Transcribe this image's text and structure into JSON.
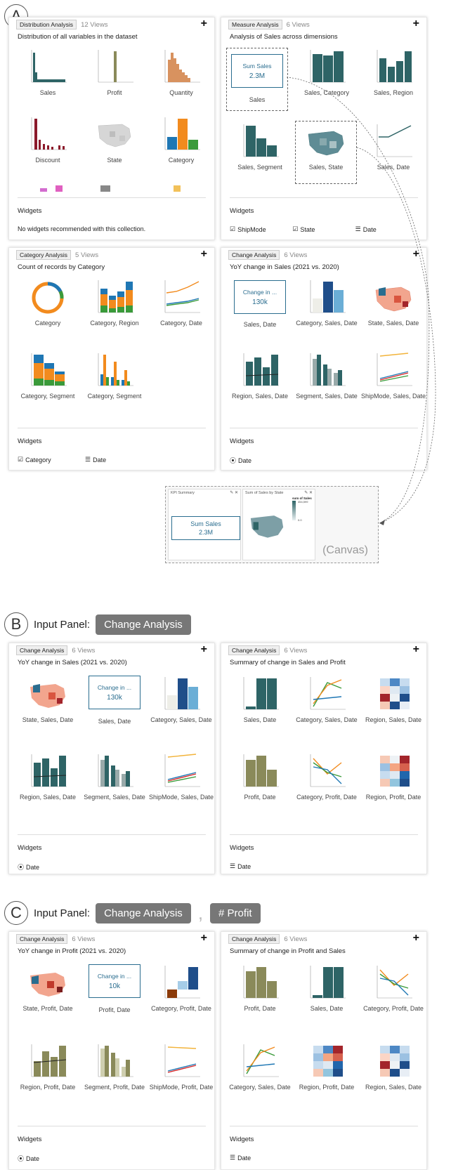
{
  "section_a": {
    "letter": "A"
  },
  "section_b": {
    "letter": "B",
    "input_label": "Input Panel:",
    "chips": [
      "Change Analysis"
    ]
  },
  "section_c": {
    "letter": "C",
    "input_label": "Input Panel:",
    "chips": [
      "Change Analysis",
      "# Profit"
    ],
    "separator": ","
  },
  "cards": {
    "a1": {
      "tag": "Distribution Analysis",
      "views": "12 Views",
      "plus": "+",
      "subtitle": "Distribution of all variables in the dataset",
      "charts": [
        "Sales",
        "Profit",
        "Quantity",
        "Discount",
        "State",
        "Category"
      ],
      "widgets_title": "Widgets",
      "widgets_message": "No widgets recommended with this collection."
    },
    "a2": {
      "tag": "Measure Analysis",
      "views": "6 Views",
      "plus": "+",
      "subtitle": "Analysis of Sales across dimensions",
      "kpi_label": "Sum Sales",
      "kpi_value": "2.3M",
      "charts": [
        "Sales",
        "Sales, Category",
        "Sales, Region",
        "Sales, Segment",
        "Sales, State",
        "Sales, Date"
      ],
      "widgets_title": "Widgets",
      "widgets": [
        {
          "icon": "☑",
          "label": "ShipMode"
        },
        {
          "icon": "☑",
          "label": "State"
        },
        {
          "icon": "☰",
          "label": "Date"
        }
      ]
    },
    "a3": {
      "tag": "Category Analysis",
      "views": "5 Views",
      "plus": "+",
      "subtitle": "Count of records by Category",
      "charts": [
        "Category",
        "Category, Region",
        "Category, Date",
        "Category, Segment",
        "Category, Segment"
      ],
      "widgets_title": "Widgets",
      "widgets": [
        {
          "icon": "☑",
          "label": "Category"
        },
        {
          "icon": "☰",
          "label": "Date"
        }
      ]
    },
    "a4": {
      "tag": "Change Analysis",
      "views": "6 Views",
      "plus": "+",
      "subtitle": "YoY change in Sales (2021 vs. 2020)",
      "kpi_label": "Change in ...",
      "kpi_value": "130k",
      "charts": [
        "Sales, Date",
        "Category, Sales, Date",
        "State, Sales, Date",
        "Region, Sales, Date",
        "Segment, Sales, Date",
        "ShipMode, Sales, Date"
      ],
      "widgets_title": "Widgets",
      "widgets": [
        {
          "icon": "⦿",
          "label": "Date"
        }
      ]
    },
    "b1": {
      "tag": "Change Analysis",
      "views": "6 Views",
      "plus": "+",
      "subtitle": "YoY change in Sales (2021 vs. 2020)",
      "kpi_label": "Change in ...",
      "kpi_value": "130k",
      "charts": [
        "State, Sales, Date",
        "Sales, Date",
        "Category, Sales, Date",
        "Region, Sales, Date",
        "Segment, Sales, Date",
        "ShipMode, Sales, Date"
      ],
      "widgets_title": "Widgets",
      "widgets": [
        {
          "icon": "⦿",
          "label": "Date"
        }
      ]
    },
    "b2": {
      "tag": "Change Analysis",
      "views": "6 Views",
      "plus": "+",
      "subtitle": "Summary of change in Sales and Profit",
      "charts": [
        "Sales, Date",
        "Category, Sales, Date",
        "Region, Sales, Date",
        "Profit, Date",
        "Category, Profit, Date",
        "Region, Profit, Date"
      ],
      "widgets_title": "Widgets",
      "widgets": [
        {
          "icon": "☰",
          "label": "Date"
        }
      ]
    },
    "c1": {
      "tag": "Change Analysis",
      "views": "6 Views",
      "plus": "+",
      "subtitle": "YoY change in Profit (2021 vs. 2020)",
      "kpi_label": "Change in ...",
      "kpi_value": "10k",
      "charts": [
        "State, Profit, Date",
        "Profit, Date",
        "Category, Profit, Date",
        "Region, Profit, Date",
        "Segment, Profit, Date",
        "ShipMode, Profit, Date"
      ],
      "widgets_title": "Widgets",
      "widgets": [
        {
          "icon": "⦿",
          "label": "Date"
        }
      ]
    },
    "c2": {
      "tag": "Change Analysis",
      "views": "6 Views",
      "plus": "+",
      "subtitle": "Summary of change in Profit and Sales",
      "charts": [
        "Profit, Date",
        "Sales, Date",
        "Category, Profit, Date",
        "Category, Sales, Date",
        "Region, Profit, Date",
        "Region, Sales, Date"
      ],
      "widgets_title": "Widgets",
      "widgets": [
        {
          "icon": "☰",
          "label": "Date"
        }
      ]
    }
  },
  "canvas": {
    "label": "(Canvas)",
    "kpi_panel_title": "KPI Summary",
    "kpi_label": "Sum Sales",
    "kpi_value": "2.3M",
    "map_panel_title": "Sum of Sales by State",
    "legend_title": "sum of Sales",
    "legend_max": "454,599",
    "legend_min": "0.0",
    "panel_icons": "✎ ✕"
  },
  "colors": {
    "teal": "#2e6466",
    "olive": "#8a8a5a",
    "blue": "#2a6d8f",
    "orange": "#f28b1e",
    "green": "#3a9a3a",
    "maroon": "#8b1a2b"
  }
}
